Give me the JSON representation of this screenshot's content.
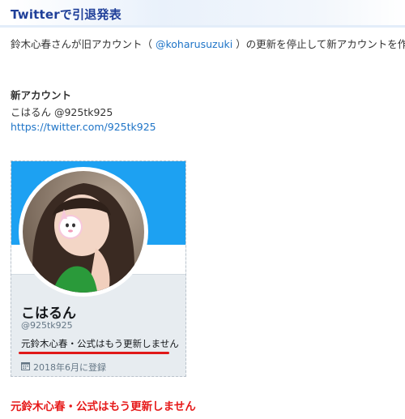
{
  "section": {
    "title": "Twitterで引退発表"
  },
  "intro": {
    "before": "鈴木心春さんが旧アカウント（ ",
    "mention": "@koharusuzuki",
    "after": " ）の更新を停止して新アカウントを作成"
  },
  "new_account": {
    "heading": "新アカウント",
    "handle_line": "こはるん @925tk925",
    "url": "https://twitter.com/925tk925"
  },
  "profile_card": {
    "name": "こはるん",
    "handle": "@925tk925",
    "bio": "元鈴木心春・公式はもう更新しません",
    "joined": "2018年6月に登録",
    "banner_color": "#1da1f2"
  },
  "highlight": {
    "text": "元鈴木心春・公式はもう更新しません",
    "color": "#e61a1a"
  },
  "icons": {
    "joined": "calendar-icon"
  }
}
